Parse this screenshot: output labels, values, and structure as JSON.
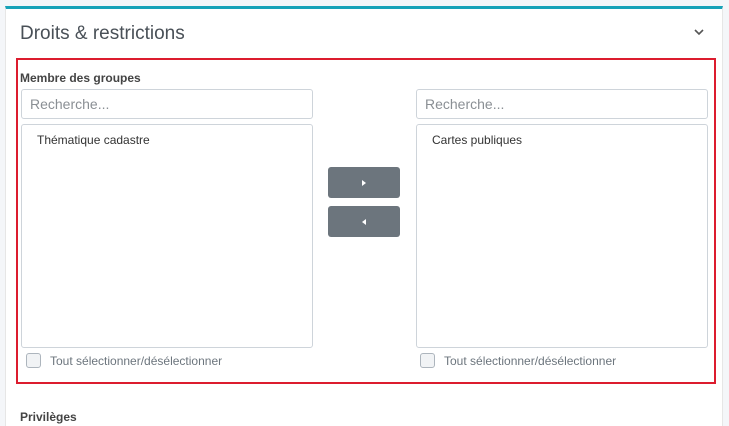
{
  "card": {
    "title": "Droits & restrictions"
  },
  "dual_list": {
    "section_label": "Membre des groupes",
    "left": {
      "search_placeholder": "Recherche...",
      "options": [
        "Thématique cadastre"
      ],
      "select_all_label": "Tout sélectionner/désélectionner"
    },
    "right": {
      "search_placeholder": "Recherche...",
      "options": [
        "Cartes publiques"
      ],
      "select_all_label": "Tout sélectionner/désélectionner"
    },
    "move_right_icon": "caret-right-icon",
    "move_left_icon": "caret-left-icon"
  },
  "next_section": {
    "label": "Privilèges"
  },
  "colors": {
    "accent": "#17a2b8",
    "highlight": "#dc1c2e",
    "button": "#6c757d"
  }
}
